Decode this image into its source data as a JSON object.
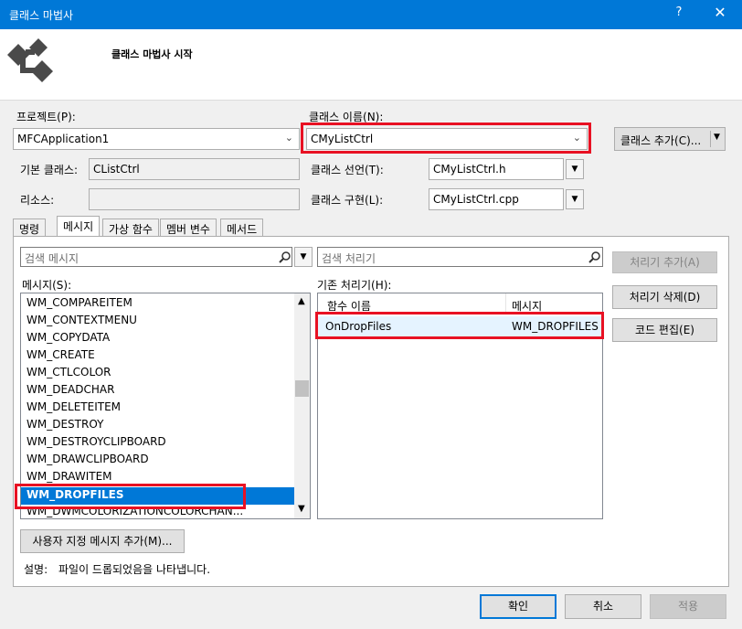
{
  "window": {
    "title": "클래스 마법사",
    "help_glyph": "?",
    "close_glyph": "✕",
    "header_title": "클래스 마법사 시작"
  },
  "project": {
    "label": "프로젝트(P):",
    "value": "MFCApplication1"
  },
  "class_name": {
    "label": "클래스 이름(N):",
    "value": "CMyListCtrl"
  },
  "add_class_button": "클래스 추가(C)...",
  "base_class": {
    "label": "기본 클래스:",
    "value": "CListCtrl"
  },
  "resource": {
    "label": "리소스:",
    "value": ""
  },
  "class_decl": {
    "label": "클래스 선언(T):",
    "value": "CMyListCtrl.h"
  },
  "class_impl": {
    "label": "클래스 구현(L):",
    "value": "CMyListCtrl.cpp"
  },
  "tabs": [
    "명령",
    "메시지",
    "가상 함수",
    "멤버 변수",
    "메서드"
  ],
  "active_tab": "메시지",
  "message_search": {
    "placeholder": "검색 메시지"
  },
  "handler_search": {
    "placeholder": "검색 처리기"
  },
  "messages": {
    "label": "메시지(S):",
    "items": [
      "WM_COMPAREITEM",
      "WM_CONTEXTMENU",
      "WM_COPYDATA",
      "WM_CREATE",
      "WM_CTLCOLOR",
      "WM_DEADCHAR",
      "WM_DELETEITEM",
      "WM_DESTROY",
      "WM_DESTROYCLIPBOARD",
      "WM_DRAWCLIPBOARD",
      "WM_DRAWITEM",
      "WM_DROPFILES",
      "WM_DWMCOLORIZATIONCOLORCHAN..."
    ],
    "selected": "WM_DROPFILES"
  },
  "handlers": {
    "label": "기존 처리기(H):",
    "columns": [
      "함수 이름",
      "메시지"
    ],
    "rows": [
      {
        "function": "OnDropFiles",
        "message": "WM_DROPFILES"
      }
    ]
  },
  "buttons": {
    "add_handler": "처리기 추가(A)",
    "delete_handler": "처리기 삭제(D)",
    "edit_code": "코드 편집(E)",
    "add_custom_message": "사용자 지정 메시지 추가(M)...",
    "ok": "확인",
    "cancel": "취소",
    "apply": "적용"
  },
  "description": {
    "label": "설명:",
    "text": "파일이 드롭되었음을 나타냅니다."
  },
  "colors": {
    "titlebar": "#0078d7",
    "selection": "#0078d7",
    "highlight_box": "#e81123"
  },
  "icons": {
    "search": "search-icon",
    "dropdown": "chevron-down-icon",
    "logo": "class-wizard-logo-icon"
  }
}
